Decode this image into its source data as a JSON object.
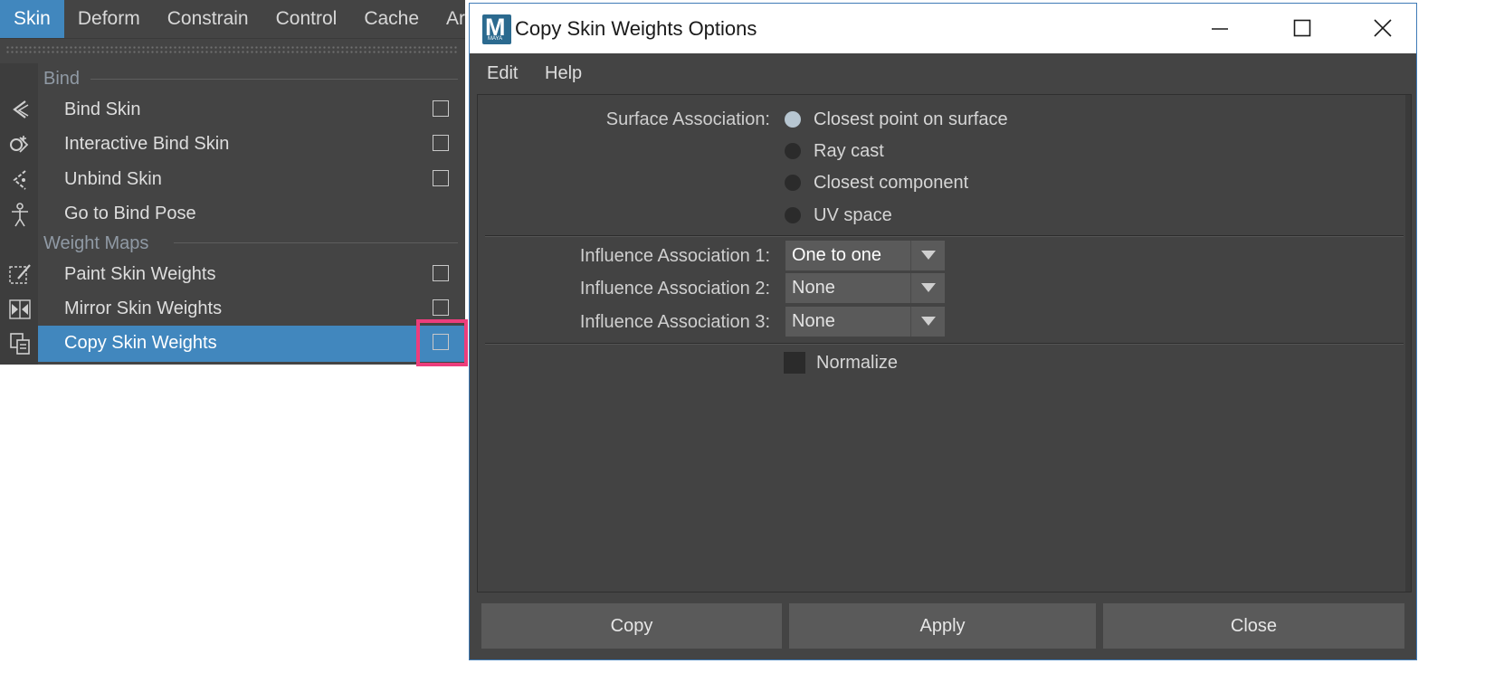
{
  "menubar": {
    "items": [
      "Skin",
      "Deform",
      "Constrain",
      "Control",
      "Cache",
      "Arr"
    ]
  },
  "menu": {
    "sections": {
      "bind": "Bind",
      "weight_maps": "Weight Maps"
    },
    "items": [
      {
        "label": "Bind Skin",
        "icon": "bind-skin-icon",
        "option_box": true
      },
      {
        "label": "Interactive Bind Skin",
        "icon": "interactive-bind-skin-icon",
        "option_box": true
      },
      {
        "label": "Unbind Skin",
        "icon": "unbind-skin-icon",
        "option_box": true
      },
      {
        "label": "Go to Bind Pose",
        "icon": "bind-pose-icon",
        "option_box": false
      },
      {
        "label": "Paint Skin Weights",
        "icon": "paint-weights-icon",
        "option_box": true
      },
      {
        "label": "Mirror Skin Weights",
        "icon": "mirror-weights-icon",
        "option_box": true
      },
      {
        "label": "Copy Skin Weights",
        "icon": "copy-weights-icon",
        "option_box": true,
        "highlighted": true
      }
    ]
  },
  "dialog": {
    "title": "Copy Skin Weights Options",
    "logo_letter": "M",
    "logo_sub": "MAYA",
    "menubar": [
      "Edit",
      "Help"
    ],
    "surface_association": {
      "label": "Surface Association:",
      "options": [
        "Closest point on surface",
        "Ray cast",
        "Closest component",
        "UV space"
      ],
      "selected": "Closest point on surface"
    },
    "influence": [
      {
        "label": "Influence Association 1:",
        "value": "One to one"
      },
      {
        "label": "Influence Association 2:",
        "value": "None"
      },
      {
        "label": "Influence Association 3:",
        "value": "None"
      }
    ],
    "normalize": {
      "label": "Normalize",
      "checked": false
    },
    "buttons": {
      "copy": "Copy",
      "apply": "Apply",
      "close": "Close"
    }
  },
  "colors": {
    "menu_bg": "#444444",
    "accent": "#4187be",
    "highlight_frame": "#ec3d7c",
    "dialog_border": "#3f7bb6"
  }
}
